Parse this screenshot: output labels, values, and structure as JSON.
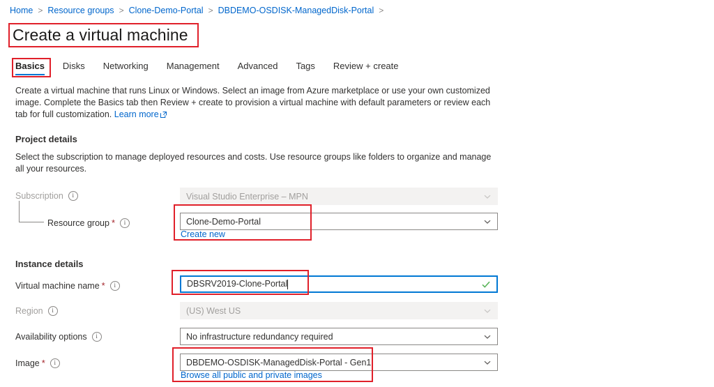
{
  "breadcrumb": {
    "items": [
      {
        "label": "Home"
      },
      {
        "label": "Resource groups"
      },
      {
        "label": "Clone-Demo-Portal"
      },
      {
        "label": "DBDEMO-OSDISK-ManagedDisk-Portal"
      }
    ],
    "separator": ">"
  },
  "page": {
    "title": "Create a virtual machine"
  },
  "tabs": [
    {
      "label": "Basics",
      "selected": true
    },
    {
      "label": "Disks",
      "selected": false
    },
    {
      "label": "Networking",
      "selected": false
    },
    {
      "label": "Management",
      "selected": false
    },
    {
      "label": "Advanced",
      "selected": false
    },
    {
      "label": "Tags",
      "selected": false
    },
    {
      "label": "Review + create",
      "selected": false
    }
  ],
  "intro": {
    "text": "Create a virtual machine that runs Linux or Windows. Select an image from Azure marketplace or use your own customized image. Complete the Basics tab then Review + create to provision a virtual machine with default parameters or review each tab for full customization.",
    "link_label": "Learn more"
  },
  "project_details": {
    "heading": "Project details",
    "description": "Select the subscription to manage deployed resources and costs. Use resource groups like folders to organize and manage all your resources.",
    "subscription": {
      "label": "Subscription",
      "value": "Visual Studio Enterprise – MPN",
      "disabled": true
    },
    "resource_group": {
      "label": "Resource group",
      "required_marker": "*",
      "value": "Clone-Demo-Portal",
      "create_new_label": "Create new"
    }
  },
  "instance_details": {
    "heading": "Instance details",
    "vm_name": {
      "label": "Virtual machine name",
      "required_marker": "*",
      "value": "DBSRV2019-Clone-Portal",
      "validation": "valid"
    },
    "region": {
      "label": "Region",
      "value": "(US) West US",
      "disabled": true
    },
    "availability_options": {
      "label": "Availability options",
      "value": "No infrastructure redundancy required"
    },
    "image": {
      "label": "Image",
      "required_marker": "*",
      "value": "DBDEMO-OSDISK-ManagedDisk-Portal - Gen1",
      "browse_label": "Browse all public and private images"
    }
  },
  "colors": {
    "accent": "#0078d4",
    "link": "#0066cc",
    "required": "#a4262c",
    "highlight": "#e0202a",
    "valid": "#5ab55a"
  }
}
